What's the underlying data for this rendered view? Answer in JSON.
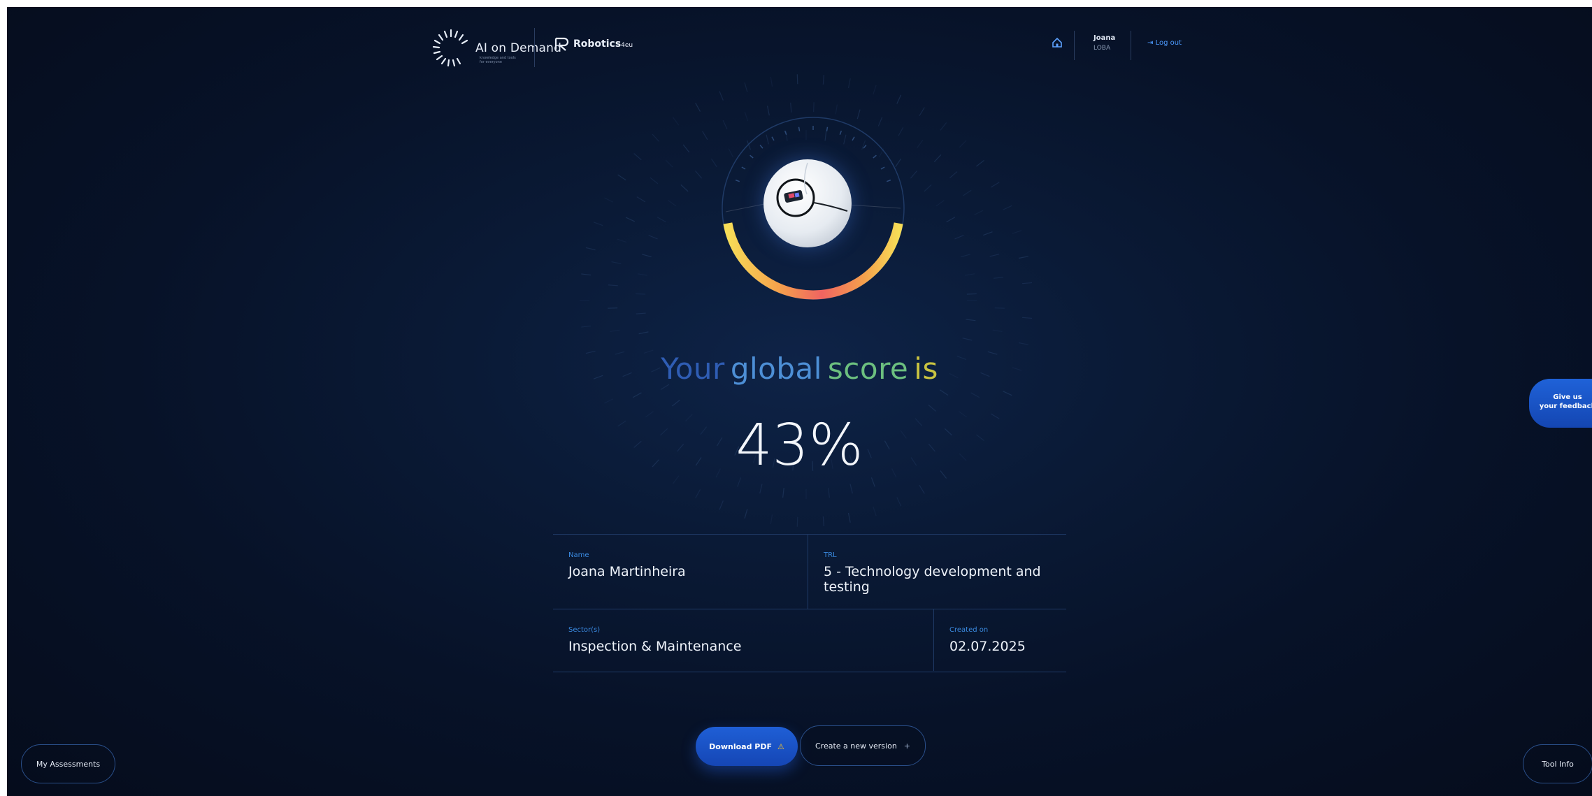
{
  "header": {
    "logo_primary": "AI on Demand",
    "logo_primary_tagline": "knowledge and tools for everyone",
    "logo_secondary": "Robotics",
    "logo_secondary_suffix": "4eu",
    "home_icon": "home-icon",
    "user_first_name": "Joana",
    "user_last_name": "LOBA",
    "logout_label": "Log out",
    "logout_icon": "logout-icon"
  },
  "score": {
    "headline_words": [
      "Your",
      "global",
      "score",
      "is"
    ],
    "value_text": "43%",
    "value_fraction": 0.43,
    "gauge_colors": [
      "#f7dd57",
      "#f5a14c",
      "#ef6461"
    ]
  },
  "info": {
    "name_label": "Name",
    "name_value": "Joana Martinheira",
    "trl_label": "TRL",
    "trl_value": "5 - Technology development and testing",
    "sector_label": "Sector(s)",
    "sector_value": "Inspection & Maintenance",
    "created_label": "Created on",
    "created_value": "02.07.2025"
  },
  "actions": {
    "download_pdf": "Download PDF",
    "download_icon": "warning-icon",
    "new_version": "Create a new version",
    "new_version_icon": "plus-icon"
  },
  "side": {
    "feedback_line1": "Give us",
    "feedback_line2": "your feedback",
    "my_assessments": "My Assessments",
    "tool_info": "Tool Info"
  }
}
